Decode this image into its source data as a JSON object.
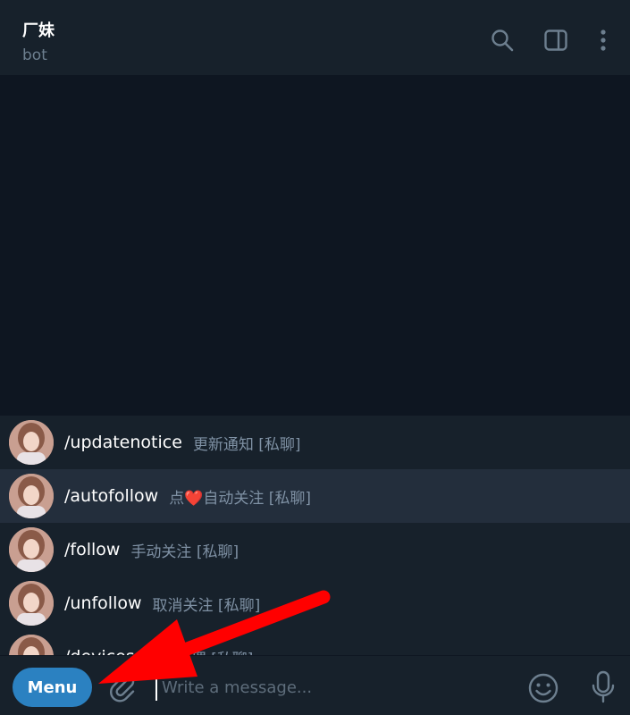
{
  "header": {
    "title": "厂妹",
    "subtitle": "bot",
    "icons": [
      "search-icon",
      "sidebar-toggle-icon",
      "more-vertical-icon"
    ]
  },
  "commands": [
    {
      "name": "/updatenotice",
      "description": "更新通知 [私聊]",
      "highlighted": false
    },
    {
      "name": "/autofollow",
      "description": "点❤️自动关注 [私聊]",
      "highlighted": true
    },
    {
      "name": "/follow",
      "description": "手动关注 [私聊]",
      "highlighted": false
    },
    {
      "name": "/unfollow",
      "description": "取消关注 [私聊]",
      "highlighted": false
    },
    {
      "name": "/devices",
      "description": "设备管理 [私聊]",
      "highlighted": false
    }
  ],
  "composer": {
    "menu_label": "Menu",
    "placeholder": "Write a message...",
    "icons": [
      "paperclip-icon",
      "emoji-icon",
      "microphone-icon"
    ]
  },
  "colors": {
    "header_bg": "#17212b",
    "chat_bg": "#0e1621",
    "highlight_row": "#232e3c",
    "menu_button": "#2b81c1",
    "annotation_arrow": "#ff0000"
  }
}
